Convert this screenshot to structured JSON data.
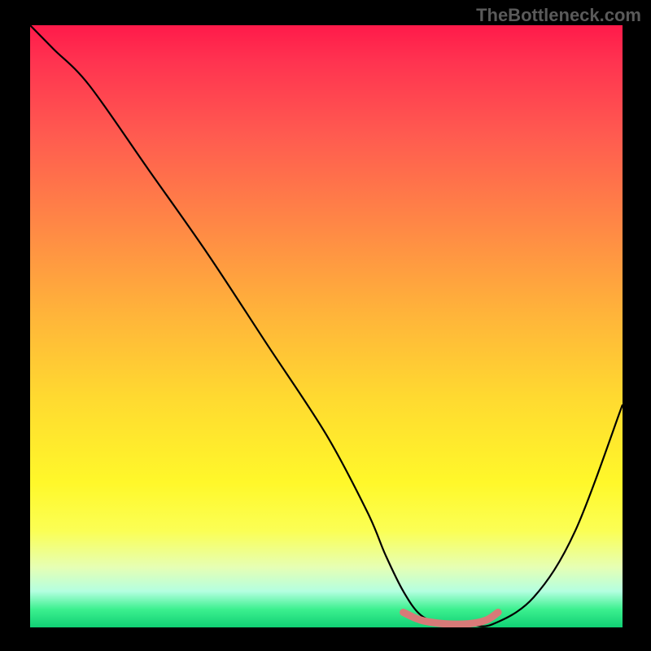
{
  "watermark": "TheBottleneck.com",
  "chart_data": {
    "type": "line",
    "title": "",
    "xlabel": "",
    "ylabel": "",
    "xlim": [
      0,
      100
    ],
    "ylim": [
      0,
      100
    ],
    "series": [
      {
        "name": "main-curve",
        "color": "#000000",
        "x": [
          0,
          4,
          10,
          20,
          30,
          40,
          50,
          57,
          60,
          63,
          66,
          70,
          74,
          78,
          85,
          92,
          100
        ],
        "y": [
          100,
          96,
          90,
          76,
          62,
          47,
          32,
          19,
          12,
          6,
          2,
          0.5,
          0.5,
          0.5,
          5,
          16,
          37
        ]
      },
      {
        "name": "highlight-band",
        "color": "#d87a78",
        "x": [
          63,
          66,
          70,
          74,
          77,
          79
        ],
        "y": [
          2.5,
          1.2,
          0.6,
          0.6,
          1.2,
          2.5
        ]
      }
    ],
    "gradient_stops": [
      {
        "pct": 0,
        "color": "#ff1a4a"
      },
      {
        "pct": 18,
        "color": "#ff5a50"
      },
      {
        "pct": 48,
        "color": "#ffb43a"
      },
      {
        "pct": 76,
        "color": "#fff82a"
      },
      {
        "pct": 94,
        "color": "#b4ffe0"
      },
      {
        "pct": 100,
        "color": "#10d074"
      }
    ]
  }
}
